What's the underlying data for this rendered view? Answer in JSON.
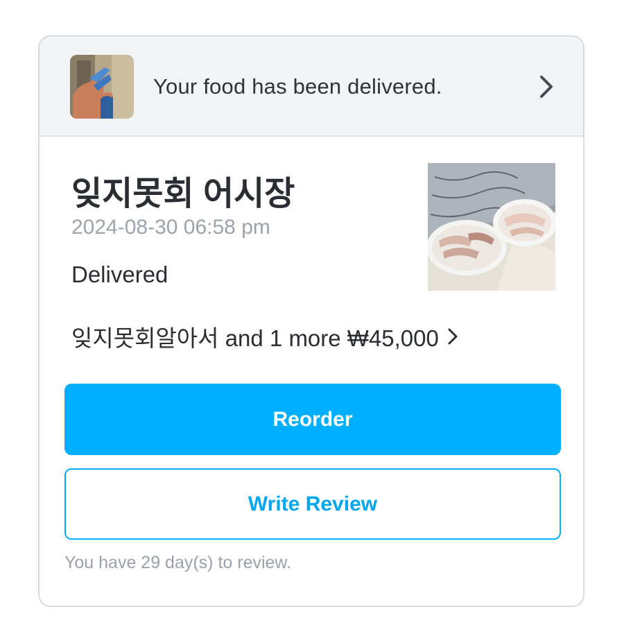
{
  "banner": {
    "message": "Your food has been delivered.",
    "thumbnail_icon": "delivery-photo",
    "chevron_icon": "chevron-right-icon"
  },
  "order": {
    "store_name": "잊지못회 어시장",
    "date": "2024-08-30 06:58 pm",
    "status": "Delivered",
    "items_summary": "잊지못회알아서 and 1 more ₩45,000",
    "photo_icon": "sashimi-platter-photo"
  },
  "actions": {
    "reorder_label": "Reorder",
    "write_review_label": "Write Review"
  },
  "review_note": "You have 29 day(s) to review.",
  "colors": {
    "accent": "#00b0ff",
    "banner_bg": "#f3f4f6",
    "text_primary": "#2a2d31",
    "text_muted": "#9da3ab"
  }
}
